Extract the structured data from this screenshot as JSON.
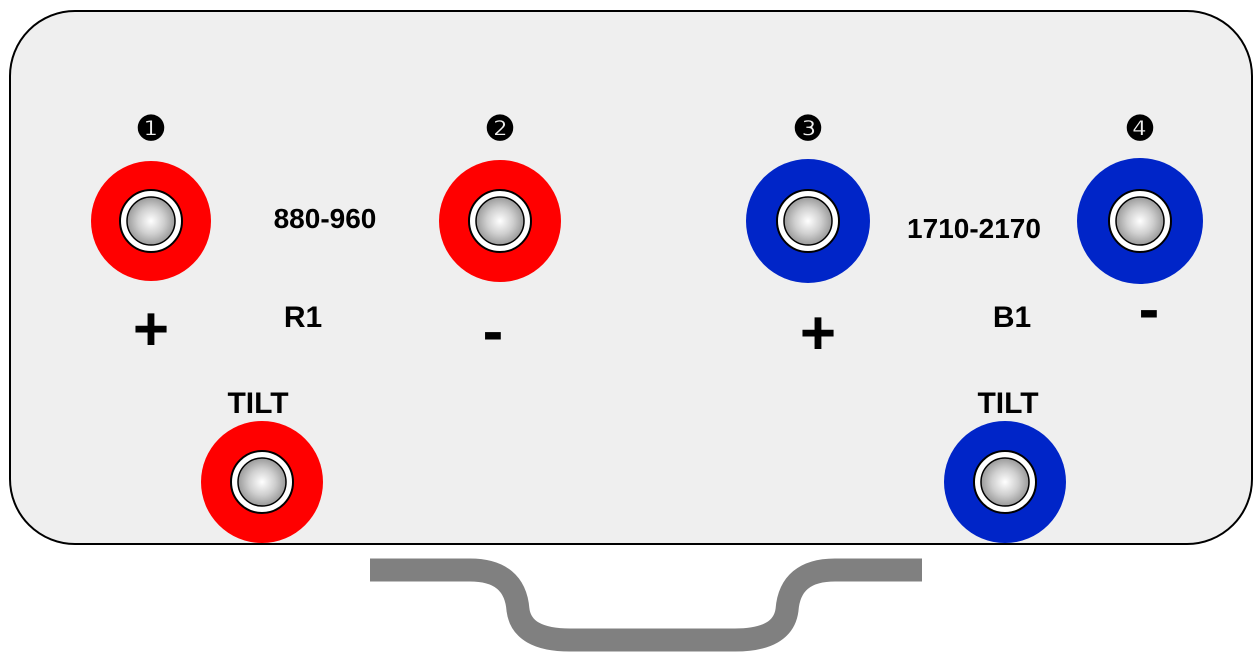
{
  "panel": {
    "colors": {
      "background": "#efefef",
      "border": "#000000",
      "red": "#ff0000",
      "blue": "#0025c8",
      "bracket": "#808080"
    }
  },
  "ports": [
    {
      "number": "❶",
      "sign": "+",
      "color": "red"
    },
    {
      "number": "❷",
      "sign": "-",
      "color": "red"
    },
    {
      "number": "❸",
      "sign": "+",
      "color": "blue"
    },
    {
      "number": "❹",
      "sign": "-",
      "color": "blue"
    }
  ],
  "bands": [
    {
      "frequency": "880-960",
      "name": "R1",
      "tilt_label": "TILT",
      "color": "red"
    },
    {
      "frequency": "1710-2170",
      "name": "B1",
      "tilt_label": "TILT",
      "color": "blue"
    }
  ]
}
